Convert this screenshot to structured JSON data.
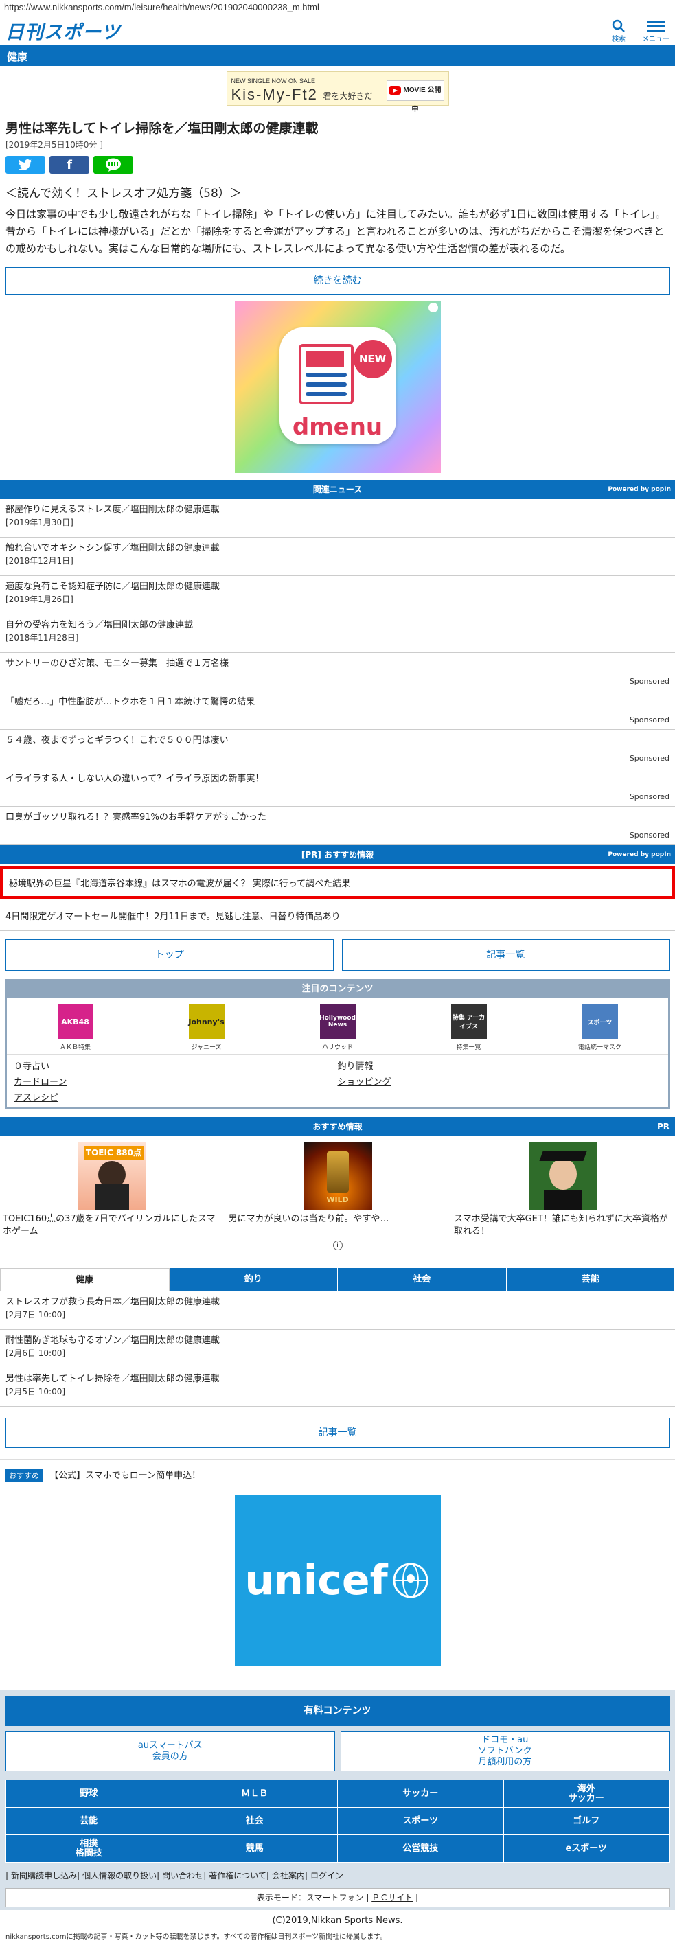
{
  "url": "https://www.nikkansports.com/m/leisure/health/news/201902040000238_m.html",
  "header": {
    "logo": "日刊スポーツ",
    "search_label": "検索",
    "menu_label": "メニュー"
  },
  "category": "健康",
  "banner_ad": {
    "line1": "NEW SINGLE NOW ON SALE",
    "main": "Kis-My-Ft2",
    "sub": "君を大好きだ",
    "cta": "MOVIE 公開中"
  },
  "article": {
    "title": "男性は率先してトイレ掃除を／塩田剛太郎の健康連載",
    "date": "[2019年2月5日10時0分 ]",
    "series": "＜読んで効く！ストレスオフ処方箋（58）＞",
    "lead": "今日は家事の中でも少し敬遠されがちな「トイレ掃除」や「トイレの使い方」に注目してみたい。誰もが必ず1日に数回は使用する「トイレ」。昔から「トイレには神様がいる」だとか「掃除をすると金運がアップする」と言われることが多いのは、汚れがちだからこそ清潔を保つべきとの戒めかもしれない。実はこんな日常的な場所にも、ストレスレベルによって異なる使い方や生活習慣の差が表れるのだ。",
    "read_more": "続きを読む"
  },
  "dmenu_ad": {
    "badge": "NEW",
    "word": "dmenu"
  },
  "related": {
    "heading": "関連ニュース",
    "powered": "Powered by popIn",
    "items": [
      {
        "title": "部屋作りに見えるストレス度／塩田剛太郎の健康連載",
        "date": "[2019年1月30日]"
      },
      {
        "title": "触れ合いでオキシトシン促す／塩田剛太郎の健康連載",
        "date": "[2018年12月1日]"
      },
      {
        "title": "適度な負荷こそ認知症予防に／塩田剛太郎の健康連載",
        "date": "[2019年1月26日]"
      },
      {
        "title": "自分の受容力を知ろう／塩田剛太郎の健康連載",
        "date": "[2018年11月28日]"
      }
    ],
    "sponsored": [
      {
        "title": "サントリーのひざ対策、モニター募集　抽選で１万名様",
        "label": "Sponsored"
      },
      {
        "title": "「嘘だろ…」中性脂肪が…トクホを１日１本続けて驚愕の結果",
        "label": "Sponsored"
      },
      {
        "title": "５４歳、夜までずっとギラつく！これで５００円は凄い",
        "label": "Sponsored"
      },
      {
        "title": "イライラする人・しない人の違いって？イライラ原因の新事実！",
        "label": "Sponsored"
      },
      {
        "title": "口臭がゴッソリ取れる！？実感率91%のお手軽ケアがすごかった",
        "label": "Sponsored"
      }
    ]
  },
  "pr": {
    "heading": "[PR] おすすめ情報",
    "powered": "Powered by popIn",
    "item1": "秘境駅界の巨星『北海道宗谷本線』はスマホの電波が届く？ 実際に行って調べた結果",
    "item2": "4日間限定ゲオマートセール開催中！2月11日まで。見逃し注意、日替り特価品あり"
  },
  "nav": {
    "top": "トップ",
    "list": "記事一覧"
  },
  "featured": {
    "heading": "注目のコンテンツ",
    "icons": [
      {
        "label": "ＡＫＢ特集",
        "img": "AKB48",
        "color": "#d6228a"
      },
      {
        "label": "ジャニーズ",
        "img": "Johnny's",
        "color": "#c8b400"
      },
      {
        "label": "ハリウッド",
        "img": "Hollywood News",
        "color": "#5b1e5e"
      },
      {
        "label": "特集一覧",
        "img": "特集 アーカイブス",
        "color": "#333333"
      },
      {
        "label": "電話統一マスク",
        "img": "スポーツ",
        "color": "#4a7fc1"
      }
    ],
    "links": [
      "０寺占い",
      "釣り情報",
      "カードローン",
      "ショッピング",
      "アスレシピ"
    ]
  },
  "recommend": {
    "heading": "おすすめ情報",
    "pr": "PR",
    "items": [
      {
        "text": "TOEIC160点の37歳を7日でバイリンガルにしたスマホゲーム",
        "img": "TOEIC 880点"
      },
      {
        "text": "男にマカが良いのは当たり前。やすや…",
        "img": "WILD"
      },
      {
        "text": "スマホ受講で大卒GET！誰にも知られずに大卒資格が取れる！",
        "img": "graduate"
      }
    ]
  },
  "tabs": [
    "健康",
    "釣り",
    "社会",
    "芸能"
  ],
  "headlines": [
    {
      "title": "ストレスオフが救う長寿日本／塩田剛太郎の健康連載",
      "date": "[2月7日 10:00]"
    },
    {
      "title": "耐性菌防ぎ地球も守るオゾン／塩田剛太郎の健康連載",
      "date": "[2月6日 10:00]"
    },
    {
      "title": "男性は率先してトイレ掃除を／塩田剛太郎の健康連載",
      "date": "[2月5日 10:00]"
    }
  ],
  "kiji_list": "記事一覧",
  "pr_line": {
    "tag": "おすすめ",
    "text": "【公式】スマホでもローン簡単申込！"
  },
  "unicef_ad": {
    "word": "unicef"
  },
  "footer": {
    "paid_heading": "有料コンテンツ",
    "paid_au": "auスマートパス\n会員の方",
    "paid_docomo": "ドコモ・au\nソフトバンク\n月額利用の方",
    "cats": [
      "野球",
      "ＭＬＢ",
      "サッカー",
      "海外\nサッカー",
      "芸能",
      "社会",
      "スポーツ",
      "ゴルフ",
      "相撲\n格闘技",
      "競馬",
      "公営競技",
      "eスポーツ"
    ],
    "links": [
      "新聞購読申し込み",
      "個人情報の取り扱い",
      "問い合わせ",
      "著作権について",
      "会社案内",
      "ログイン"
    ],
    "mode_prefix": "表示モード：スマートフォン",
    "mode_pc": "ＰＣサイト",
    "copyright": "(C)2019,Nikkan Sports News.",
    "notice": "nikkansports.comに掲載の記事・写真・カット等の転載を禁じます。すべての著作権は日刊スポーツ新聞社に帰属します。"
  },
  "colors": {
    "brand": "#0a6fbd",
    "sponsor_border": "#e00000",
    "featured": "#8fa6bd"
  }
}
